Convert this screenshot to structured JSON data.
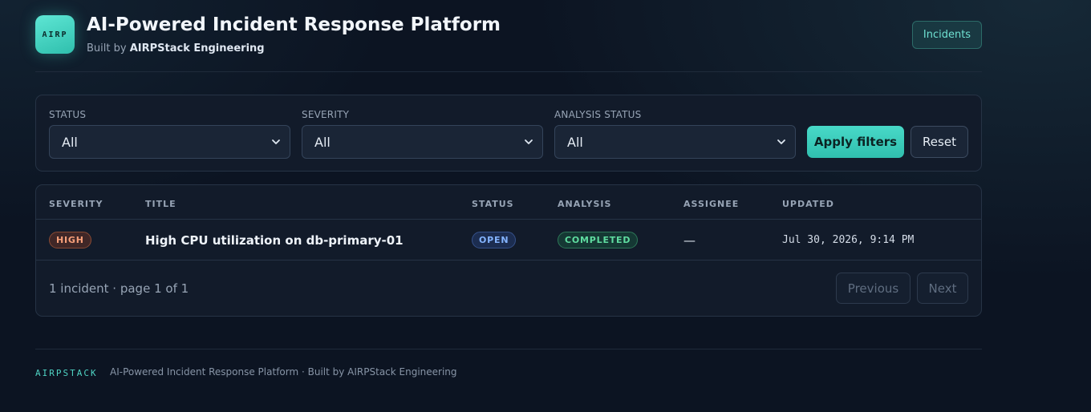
{
  "header": {
    "logo_text": "AIRP",
    "title": "AI-Powered Incident Response Platform",
    "subtitle_prefix": "Built by ",
    "subtitle_org": "AIRPStack Engineering",
    "nav_label": "Incidents"
  },
  "filters": {
    "status": {
      "label": "STATUS",
      "value": "All"
    },
    "severity": {
      "label": "SEVERITY",
      "value": "All"
    },
    "analysis": {
      "label": "ANALYSIS STATUS",
      "value": "All"
    },
    "apply_label": "Apply filters",
    "reset_label": "Reset"
  },
  "table": {
    "columns": [
      "SEVERITY",
      "TITLE",
      "STATUS",
      "ANALYSIS",
      "ASSIGNEE",
      "UPDATED"
    ],
    "rows": [
      {
        "severity": "HIGH",
        "title": "High CPU utilization on db-primary-01",
        "status": "OPEN",
        "analysis": "COMPLETED",
        "assignee": "—",
        "updated": "Jul 30, 2026, 9:14 PM"
      }
    ],
    "summary": "1 incident · page 1 of 1",
    "prev_label": "Previous",
    "next_label": "Next"
  },
  "footer": {
    "brand": "AIRPSTACK",
    "text": "AI-Powered Incident Response Platform · Built by AIRPStack Engineering"
  },
  "colors": {
    "accent": "#40d6c4",
    "background": "#0c1422",
    "severity_high": "#f7a07a",
    "status_open": "#84b4ff",
    "analysis_completed": "#5fdca0"
  },
  "icons": {
    "select_chevron": "chevron-down-icon"
  }
}
